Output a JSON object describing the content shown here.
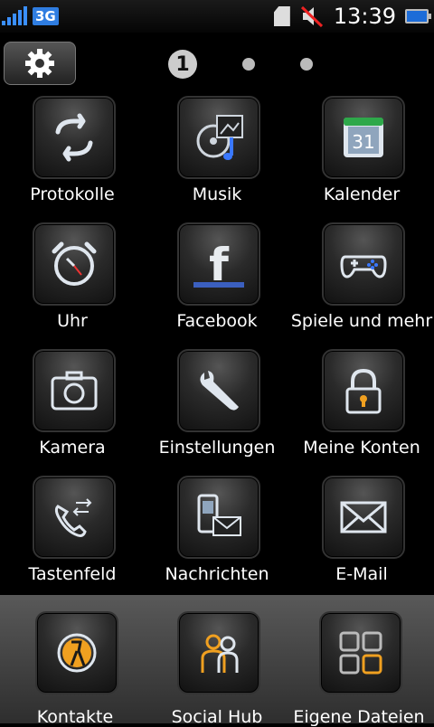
{
  "status": {
    "network": "3G",
    "time": "13:39"
  },
  "pager": {
    "current_page": "1"
  },
  "apps": [
    {
      "label": "Protokolle",
      "icon": "sync-arrows-icon"
    },
    {
      "label": "Musik",
      "icon": "music-icon"
    },
    {
      "label": "Kalender",
      "icon": "calendar-icon",
      "badge": "31"
    },
    {
      "label": "Uhr",
      "icon": "alarm-clock-icon"
    },
    {
      "label": "Facebook",
      "icon": "facebook-icon",
      "glyph": "f"
    },
    {
      "label": "Spiele und mehr",
      "icon": "gamepad-icon"
    },
    {
      "label": "Kamera",
      "icon": "camera-icon"
    },
    {
      "label": "Einstellungen",
      "icon": "wrench-icon"
    },
    {
      "label": "Meine Konten",
      "icon": "lock-icon"
    },
    {
      "label": "Tastenfeld",
      "icon": "phone-icon"
    },
    {
      "label": "Nachrichten",
      "icon": "messages-icon"
    },
    {
      "label": "E-Mail",
      "icon": "envelope-icon"
    }
  ],
  "dock": [
    {
      "label": "Kontakte",
      "icon": "contacts-icon"
    },
    {
      "label": "Social Hub",
      "icon": "people-icon"
    },
    {
      "label": "Eigene Dateien",
      "icon": "files-grid-icon"
    }
  ]
}
